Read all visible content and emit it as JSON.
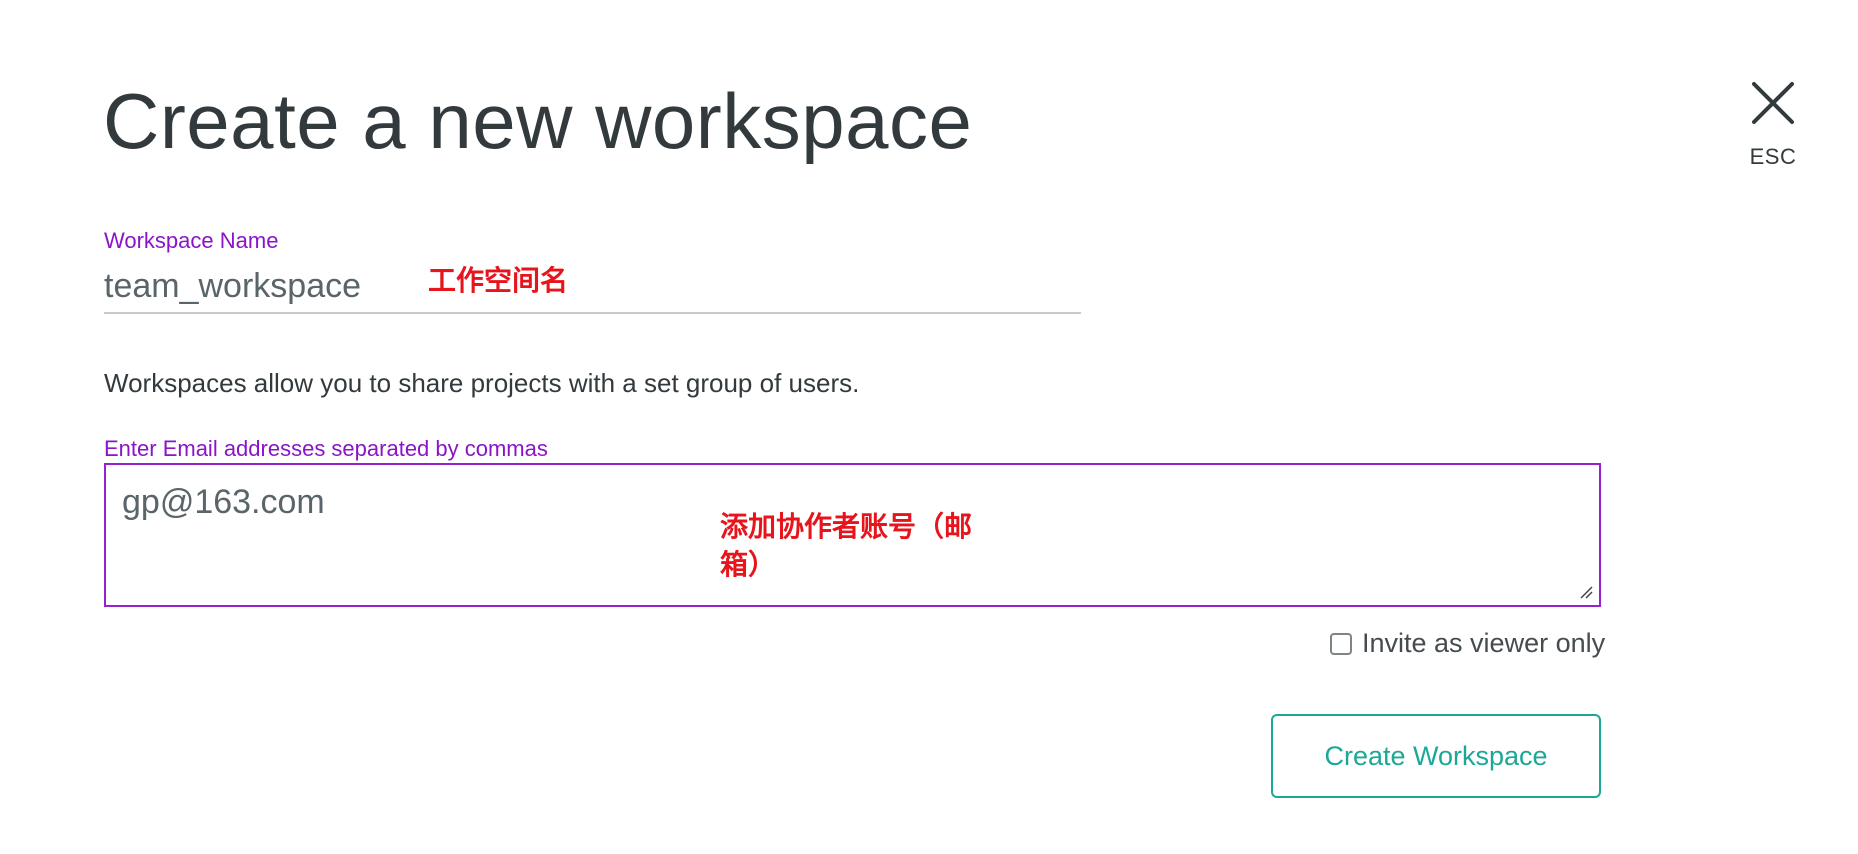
{
  "dialog": {
    "title": "Create a new workspace",
    "close_label": "ESC"
  },
  "workspace_name": {
    "label": "Workspace Name",
    "value": "team_workspace",
    "annotation": "工作空间名"
  },
  "description": "Workspaces allow you to share projects with a set group of users.",
  "emails": {
    "label": "Enter Email addresses separated by commas",
    "value": "gp@163.com",
    "annotation": "添加协作者账号（邮箱）"
  },
  "viewer_only": {
    "label": "Invite as viewer only",
    "checked": false
  },
  "actions": {
    "create_label": "Create Workspace"
  },
  "colors": {
    "label_purple": "#8b14c9",
    "accent_teal": "#1ba896",
    "annotation_red": "#e8141c"
  }
}
